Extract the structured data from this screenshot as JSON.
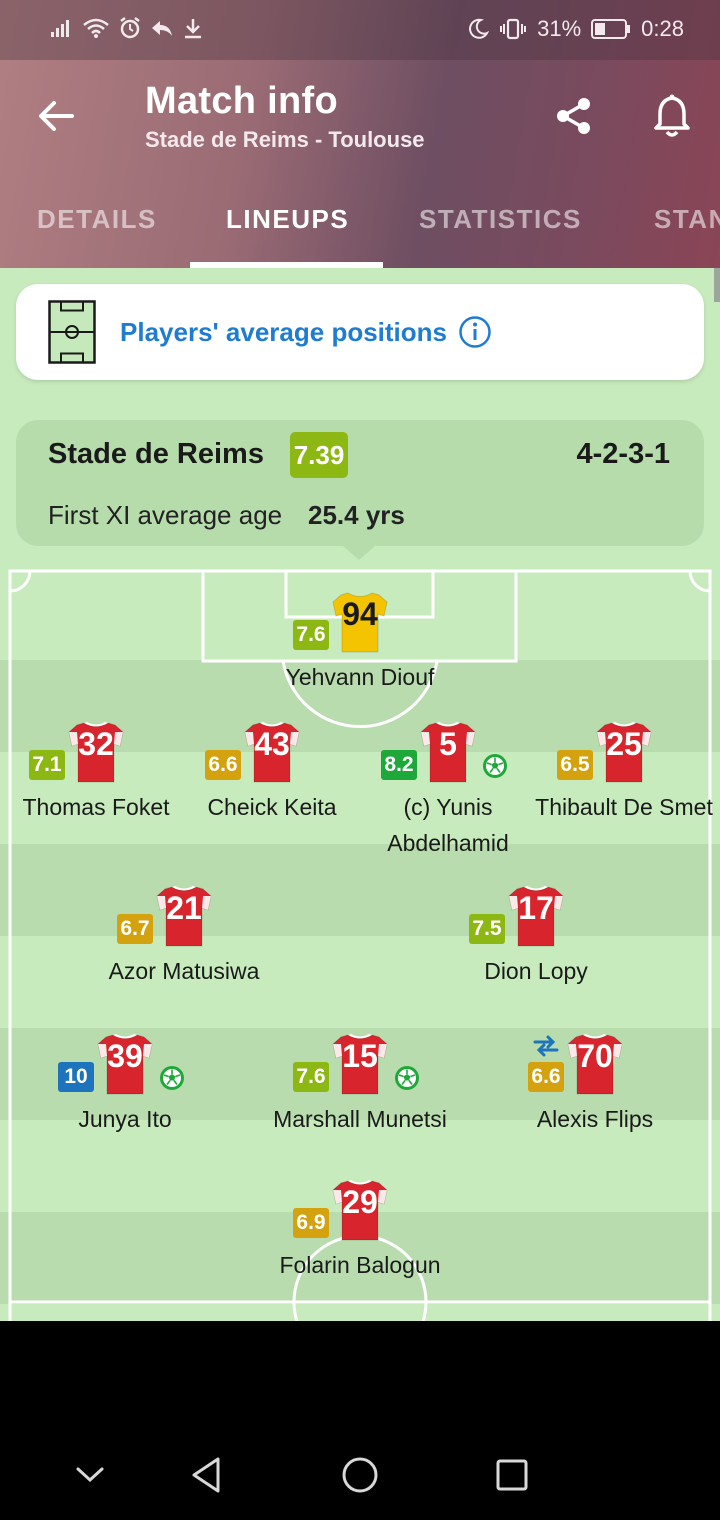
{
  "status_bar": {
    "battery": "31%",
    "time": "0:28"
  },
  "header": {
    "title": "Match info",
    "subtitle": "Stade de Reims - Toulouse"
  },
  "tabs": [
    {
      "label": "DETAILS",
      "active": false
    },
    {
      "label": "LINEUPS",
      "active": true
    },
    {
      "label": "STATISTICS",
      "active": false
    },
    {
      "label": "STANDINGS",
      "active": false
    }
  ],
  "avg_positions": {
    "label": "Players' average positions"
  },
  "team": {
    "name": "Stade de Reims",
    "rating": "7.39",
    "formation": "4-2-3-1",
    "age_label": "First XI average age",
    "age_value": "25.4 yrs"
  },
  "players": [
    {
      "number": "94",
      "rating": "7.6",
      "name": "Yehvann Diouf",
      "goalkeeper": true
    },
    {
      "number": "32",
      "rating": "7.1",
      "name": "Thomas Foket"
    },
    {
      "number": "43",
      "rating": "6.6",
      "name": "Cheick Keita"
    },
    {
      "number": "5",
      "rating": "8.2",
      "name": "(c) Yunis Abdelhamid",
      "goal": true
    },
    {
      "number": "25",
      "rating": "6.5",
      "name": "Thibault De Smet"
    },
    {
      "number": "21",
      "rating": "6.7",
      "name": "Azor Matusiwa"
    },
    {
      "number": "17",
      "rating": "7.5",
      "name": "Dion Lopy"
    },
    {
      "number": "39",
      "rating": "10",
      "name": "Junya Ito",
      "goal": true
    },
    {
      "number": "15",
      "rating": "7.6",
      "name": "Marshall Munetsi",
      "goal": true
    },
    {
      "number": "70",
      "rating": "6.6",
      "name": "Alexis Flips",
      "substituted": true
    },
    {
      "number": "29",
      "rating": "6.9",
      "name": "Folarin Balogun"
    }
  ],
  "rating_colors": {
    "excellent": "#1fa83a",
    "very_good": "#8db814",
    "good": "#d4a20e",
    "outstanding": "#1d74bd"
  },
  "colors": {
    "shirt": "#d8242c",
    "gk_shirt": "#f5c400",
    "accent_blue": "#1e7dd0"
  },
  "nav": {
    "items": [
      "chevron-down-icon",
      "back-triangle-icon",
      "home-circle-icon",
      "recents-square-icon"
    ]
  }
}
